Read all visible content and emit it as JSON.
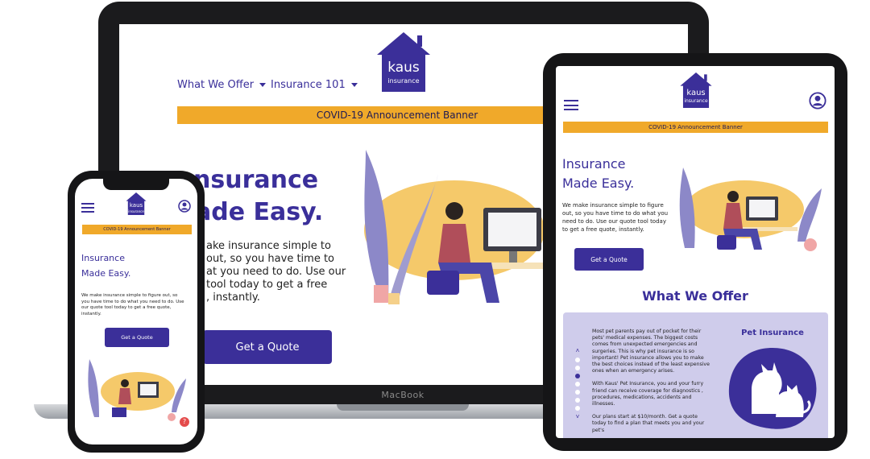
{
  "laptop": {
    "nav": {
      "what_we_offer": "What We Offer",
      "insurance_101": "Insurance 101"
    },
    "logo": {
      "brand": "kaus",
      "sub": "insurance"
    },
    "banner": "COVID-19 Announcement Banner",
    "hero": {
      "title_line1": "nsurance",
      "title_line2": "ade Easy.",
      "body_line1": "ake insurance simple to",
      "body_line2": "out, so you have time to",
      "body_line3": "at you need to do. Use our",
      "body_line4": "tool today to get a free",
      "body_line5": ", instantly.",
      "cta": "Get a Quote"
    },
    "brand_label": "MacBook"
  },
  "phone": {
    "logo": {
      "brand": "kaus",
      "sub": "insurance"
    },
    "banner": "COVID-19 Announcement Banner",
    "hero": {
      "title_line1": "Insurance",
      "title_line2": "Made Easy.",
      "body": "We make insurance simple to figure out, so you have time to do what you need to do. Use our quote tool today to get a free quote, instantly.",
      "cta": "Get a Quote"
    },
    "help_badge": "?"
  },
  "tablet": {
    "logo": {
      "brand": "kaus",
      "sub": "insurance"
    },
    "banner": "COVID-19 Announcement Banner",
    "hero": {
      "title_line1": "Insurance",
      "title_line2": "Made Easy.",
      "body": "We make insurance simple to figure out, so you have time to do what you need to do. Use our quote tool today to get a free quote, instantly.",
      "cta": "Get a Quote"
    },
    "offer": {
      "heading": "What We Offer",
      "card_title": "Pet Insurance",
      "para1": "Most pet parents pay out of pocket for their pets' medical expenses. The biggest costs comes from unexpected emergencies and surgeries. This is why pet insurance is so important! Pet insurance allows you to make the best choices instead of the least expensive ones when an emergency arises.",
      "para2": "With Kaus' Pet Insurance, you and your furry friend can receive coverage for diagnostics , procedures, medications, accidents and illnesses.",
      "para3": "Our plans start at $10/month. Get a quote today to find a plan that meets you and your pet's",
      "active_slide": 3
    }
  },
  "colors": {
    "brand": "#3b2f99",
    "banner": "#f0a92a",
    "card_bg": "#cfcceb",
    "illustration_blob": "#f5c96a"
  }
}
